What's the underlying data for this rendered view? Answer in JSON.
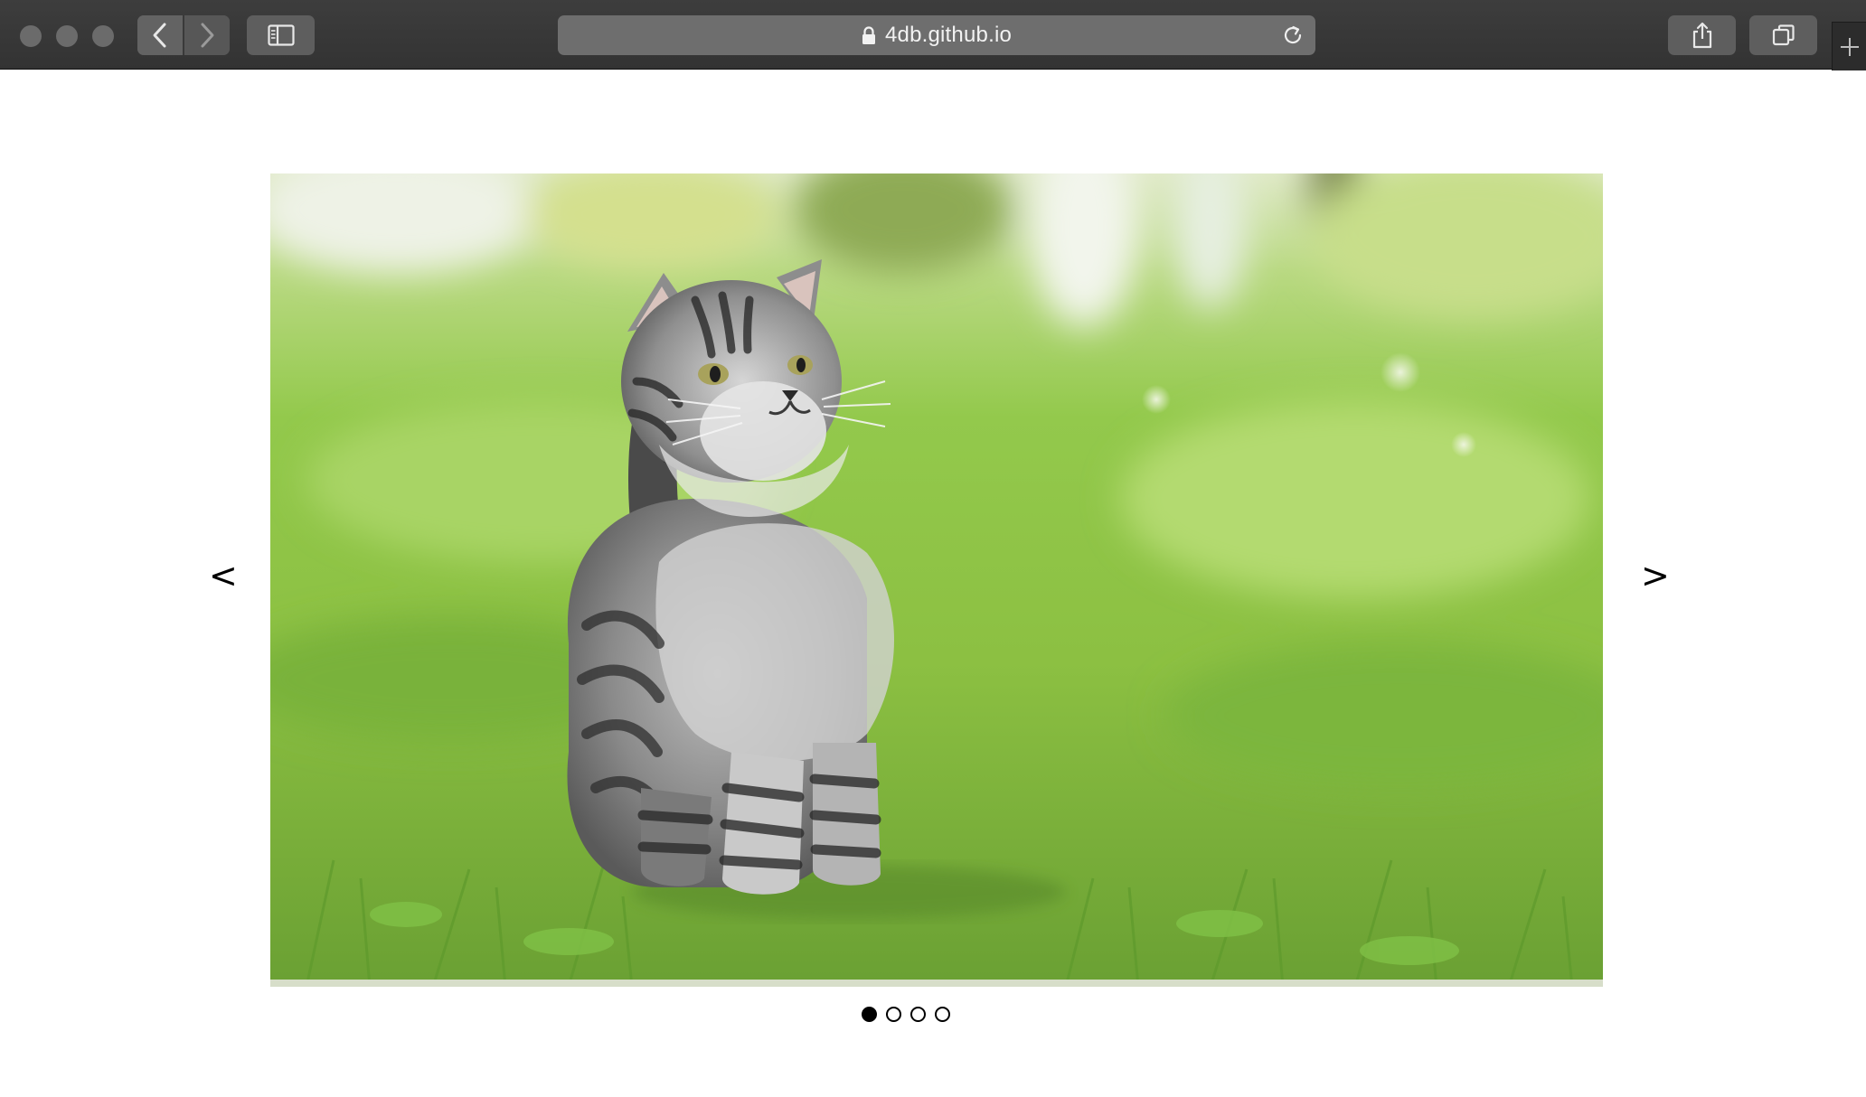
{
  "browser": {
    "url": "4db.github.io",
    "icons": {
      "back": "chevron-left-icon",
      "forward": "chevron-right-icon",
      "sidebar": "sidebar-icon",
      "lock": "lock-icon",
      "reload": "reload-icon",
      "share": "share-icon",
      "tabs": "tabs-icon",
      "new_tab": "plus-icon"
    }
  },
  "carousel": {
    "prev_label": "<",
    "next_label": ">",
    "slide_count": 4,
    "active_index": 0,
    "slide": {
      "subject": "kitten"
    }
  }
}
